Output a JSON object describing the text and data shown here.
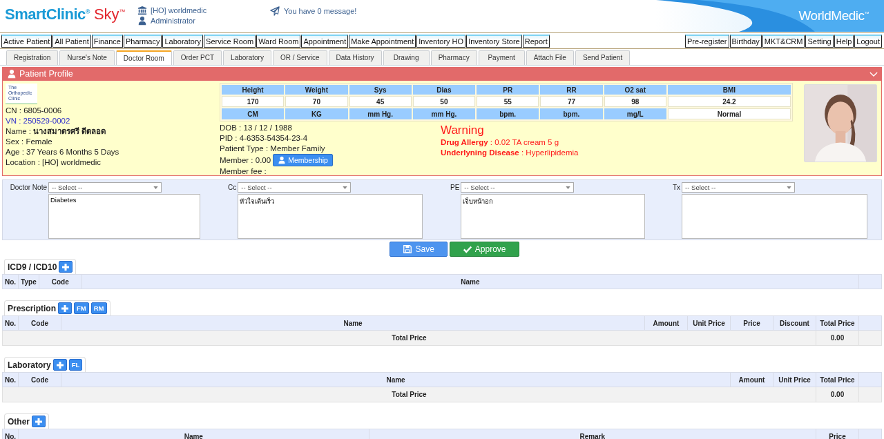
{
  "header": {
    "logo_name": "SmartClinic$^{®}$",
    "logo_product": "Sky$^{™}$",
    "branch": "[HO] worldmedic",
    "user": "Administrator",
    "message": "You have 0 message!",
    "brand": "WorldMedic$^{™}$"
  },
  "main_menu": {
    "left": [
      "Active Patient",
      "All Patient",
      "Finance",
      "Pharmacy",
      "Laboratory",
      "Service Room",
      "Ward Room",
      "Appointment",
      "Make Appointment",
      "Inventory HO",
      "Inventory Store",
      "Report"
    ],
    "right": [
      "Pre-register",
      "Birthday",
      "MKT&CRM",
      "Setting",
      "Help",
      "Logout"
    ]
  },
  "tabs": [
    {
      "label": "Registration",
      "selected": false
    },
    {
      "label": "Nurse's Note",
      "selected": false
    },
    {
      "label": "Doctor Room",
      "selected": true
    },
    {
      "label": "Order PCT",
      "selected": false
    },
    {
      "label": "Laboratory",
      "selected": false
    },
    {
      "label": "OR / Service",
      "selected": false
    },
    {
      "label": "Data History",
      "selected": false
    },
    {
      "label": "Drawing",
      "selected": false
    },
    {
      "label": "Pharmacy",
      "selected": false
    },
    {
      "label": "Payment",
      "selected": false
    },
    {
      "label": "Attach File",
      "selected": false
    },
    {
      "label": "Send Patient",
      "selected": false
    }
  ],
  "profile": {
    "title": "Patient Profile",
    "expanded": true,
    "clinic_logo": [
      "The",
      "Orthopedic",
      "Clinic"
    ],
    "info": [
      {
        "text": "CN : 6805-0006",
        "kind": "plain"
      },
      {
        "text": "VN : 250529-0002",
        "kind": "link"
      },
      {
        "text": "Name : **นางสมาตรศรี ดีตลอด**",
        "kind": "plain"
      },
      {
        "text": "Sex : Female",
        "kind": "plain"
      },
      {
        "text": "Age : 37 Years 6 Months 5 Days",
        "kind": "plain"
      },
      {
        "text": "Location : [HO] worldmedic",
        "kind": "plain"
      }
    ],
    "vitals": [
      {
        "label": "Height",
        "value": "170",
        "unit": "CM",
        "kind": "measure"
      },
      {
        "label": "Weight",
        "value": "70",
        "unit": "KG",
        "kind": "measure"
      },
      {
        "label": "Sys",
        "value": "45",
        "unit": "mm Hg.",
        "kind": "measure"
      },
      {
        "label": "Dias",
        "value": "50",
        "unit": "mm Hg.",
        "kind": "measure"
      },
      {
        "label": "PR",
        "value": "55",
        "unit": "bpm.",
        "kind": "measure"
      },
      {
        "label": "RR",
        "value": "77",
        "unit": "bpm.",
        "kind": "measure"
      },
      {
        "label": "O2 sat",
        "value": "98",
        "unit": "mg/L",
        "kind": "measure"
      },
      {
        "label": "BMI",
        "value": "24.2",
        "unit": "Normal",
        "kind": "status"
      }
    ],
    "details": [
      "DOB : 13 / 12 / 1988",
      "PID : 4-6353-54354-23-4",
      "Patient Type : Member Family"
    ],
    "member": "Member : 0.00",
    "membership_button": "Membership",
    "member_fee": "Member fee :",
    "warning": {
      "title": "Warning",
      "lines": [
        "**Drug Allergy** : 0.02 TA cream 5 g",
        "**Underlyning Disease** : Hyperlipidemia"
      ]
    }
  },
  "notes": [
    {
      "label": "Doctor Note",
      "select": {
        "placeholder": "-- Select --"
      },
      "value": "Diabetes"
    },
    {
      "label": "Cc",
      "select": {
        "placeholder": "-- Select --"
      },
      "value": "หัวใจเต้นเร็ว"
    },
    {
      "label": "PE",
      "select": {
        "placeholder": "-- Select --"
      },
      "value": "เจ็บหน้าอก"
    },
    {
      "label": "Tx",
      "select": {
        "placeholder": "-- Select --"
      }
    }
  ],
  "actions": [
    {
      "label": "Save",
      "kind": "save"
    },
    {
      "label": "Approve",
      "kind": "approve"
    }
  ],
  "sections": [
    {
      "title": "ICD9 / ICD10",
      "buttons": [
        {
          "kind": "add"
        }
      ],
      "columns": [
        {
          "label": "No.",
          "kind": "narrow"
        },
        {
          "label": "Type",
          "kind": "narrow"
        },
        {
          "label": "Code",
          "kind": "code"
        },
        {
          "label": "Name",
          "kind": "name"
        },
        {
          "kind": "spacer"
        }
      ]
    },
    {
      "title": "Prescription",
      "buttons": [
        {
          "kind": "add"
        },
        {
          "kind": "text",
          "label": "FM"
        },
        {
          "kind": "text",
          "label": "RM"
        }
      ],
      "columns": [
        {
          "label": "No.",
          "kind": "narrow"
        },
        {
          "label": "Code",
          "kind": "code"
        },
        {
          "label": "Name",
          "kind": "name"
        },
        {
          "label": "Amount",
          "kind": "num"
        },
        {
          "label": "Unit Price",
          "kind": "num"
        },
        {
          "label": "Price",
          "kind": "num"
        },
        {
          "label": "Discount",
          "kind": "num"
        },
        {
          "label": "Total Price",
          "kind": "num"
        },
        {
          "kind": "spacer"
        }
      ],
      "total": {
        "label": "Total Price",
        "value": "0.00"
      }
    },
    {
      "title": "Laboratory",
      "buttons": [
        {
          "kind": "add"
        },
        {
          "kind": "text",
          "label": "FL"
        }
      ],
      "columns": [
        {
          "label": "No.",
          "kind": "narrow"
        },
        {
          "label": "Code",
          "kind": "code"
        },
        {
          "label": "Name",
          "kind": "name"
        },
        {
          "label": "Amount",
          "kind": "num"
        },
        {
          "label": "Unit Price",
          "kind": "num"
        },
        {
          "label": "Total Price",
          "kind": "num"
        },
        {
          "kind": "spacer"
        }
      ],
      "total": {
        "label": "Total Price",
        "value": "0.00"
      }
    },
    {
      "title": "Other",
      "buttons": [
        {
          "kind": "add"
        }
      ],
      "columns": [
        {
          "label": "No.",
          "kind": "narrow"
        },
        {
          "label": "Name",
          "kind": "name"
        },
        {
          "label": "Remark",
          "kind": "name"
        },
        {
          "label": "Price",
          "kind": "code"
        },
        {
          "kind": "spacer"
        }
      ]
    }
  ]
}
